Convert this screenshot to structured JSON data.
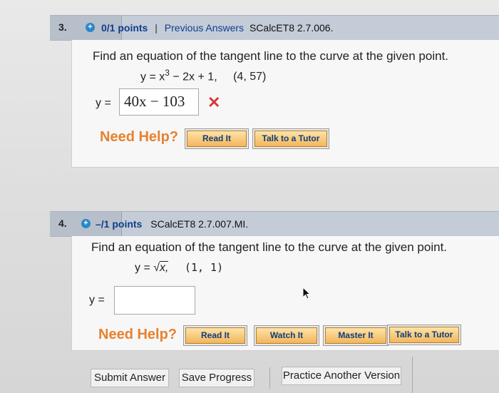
{
  "q3": {
    "number": "3.",
    "points": "0/1 points",
    "separator": "|",
    "previous_answers": "Previous Answers",
    "code": "SCalcET8 2.7.006.",
    "prompt": "Find an equation of the tangent line to the curve at the given point.",
    "eq_lhs": "y = x",
    "eq_exp": "3",
    "eq_rhs": " − 2x + 1,",
    "point": "(4, 57)",
    "answer_label": "y =",
    "answer_value": "40x − 103",
    "status_mark": "✕",
    "need_help": "Need Help?",
    "help_buttons": [
      "Read It",
      "Talk to a Tutor"
    ]
  },
  "q4": {
    "number": "4.",
    "points": "–/1 points",
    "code": "SCalcET8 2.7.007.MI.",
    "prompt": "Find an equation of the tangent line to the curve at the given point.",
    "eq_lhs": "y = ",
    "eq_radical": "x,",
    "point": "(1, 1)",
    "answer_label": "y =",
    "answer_value": "",
    "need_help": "Need Help?",
    "help_buttons": [
      "Read It",
      "Watch It",
      "Master It",
      "Talk to a Tutor"
    ]
  },
  "actions": {
    "submit": "Submit Answer",
    "save": "Save Progress",
    "practice": "Practice Another Version"
  },
  "colors": {
    "header_bg": "#c4ccd8",
    "link_blue": "#0f3e8a",
    "need_help_orange": "#e8812e",
    "error_red": "#d7373c",
    "help_button": "#f3b65b"
  }
}
